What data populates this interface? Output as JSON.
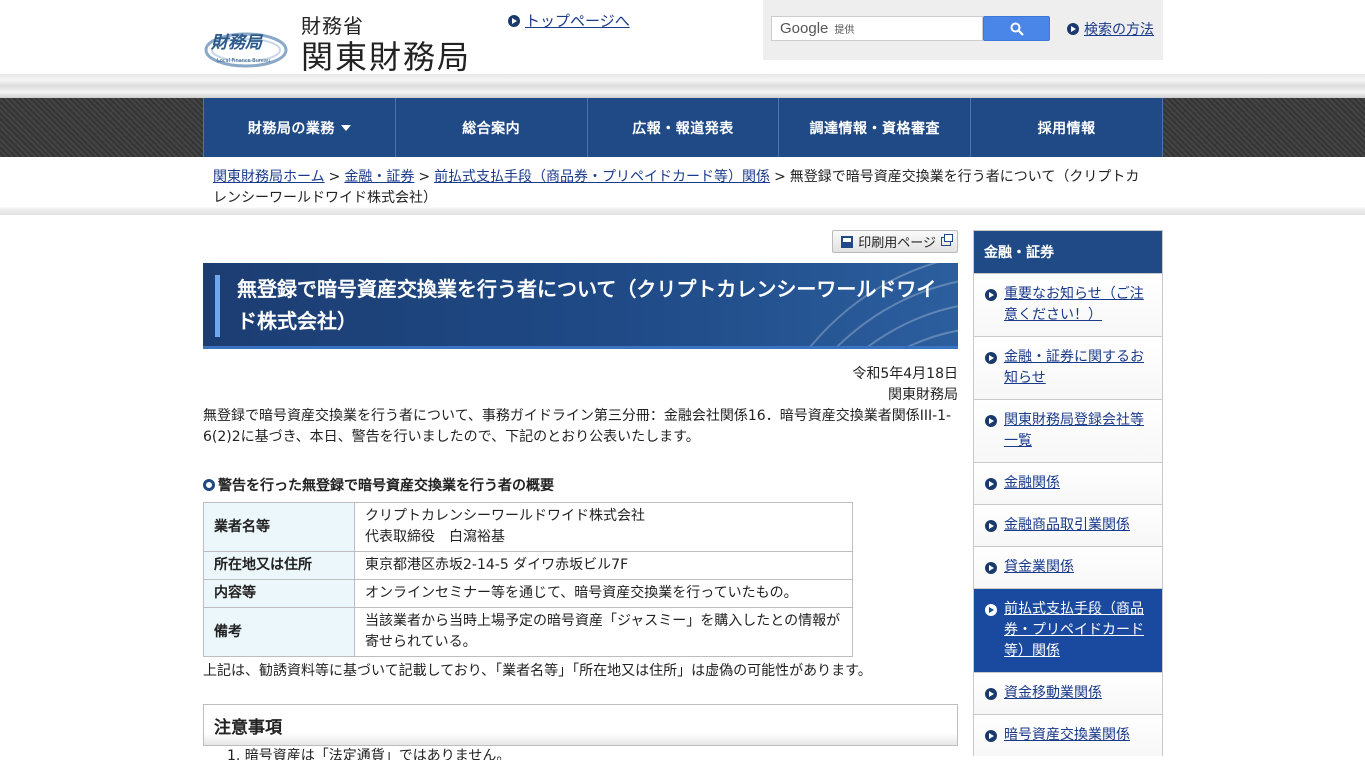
{
  "header": {
    "logo_small": "財務省",
    "logo_big": "関東財務局",
    "logo_emblem_text": "財務局",
    "logo_emblem_sub": "Local Finance Bureau",
    "top_link": "トップページへ",
    "search": {
      "google_label": "Google",
      "provided_label": "提供",
      "help_link": "検索の方法"
    }
  },
  "nav": {
    "items": [
      {
        "label": "財務局の業務",
        "has_dropdown": true
      },
      {
        "label": "総合案内"
      },
      {
        "label": "広報・報道発表"
      },
      {
        "label": "調達情報・資格審査"
      },
      {
        "label": "採用情報"
      }
    ]
  },
  "breadcrumb": {
    "items": [
      "関東財務局ホーム",
      "金融・証券",
      "前払式支払手段（商品券・プリペイドカード等）関係"
    ],
    "current": "無登録で暗号資産交換業を行う者について（クリプトカレンシーワールドワイド株式会社）",
    "separator": ">"
  },
  "main": {
    "print_label": "印刷用ページ",
    "title": "無登録で暗号資産交換業を行う者について（クリプトカレンシーワールドワイド株式会社）",
    "date": "令和5年4月18日",
    "issuer": "関東財務局",
    "intro": "無登録で暗号資産交換業を行う者について、事務ガイドライン第三分冊：金融会社関係16．暗号資産交換業者関係III-1-6(2)2に基づき、本日、警告を行いましたので、下記のとおり公表いたします。",
    "section_heading": "警告を行った無登録で暗号資産交換業を行う者の概要",
    "table": [
      {
        "label": "業者名等",
        "value_lines": [
          "クリプトカレンシーワールドワイド株式会社",
          "代表取締役　白瀉裕基"
        ]
      },
      {
        "label": "所在地又は住所",
        "value_lines": [
          "東京都港区赤坂2-14-5  ダイワ赤坂ビル7F"
        ]
      },
      {
        "label": "内容等",
        "value_lines": [
          "オンラインセミナー等を通じて、暗号資産交換業を行っていたもの。"
        ]
      },
      {
        "label": "備考",
        "value_lines": [
          "当該業者から当時上場予定の暗号資産「ジャスミー」を購入したとの情報が寄せられている。"
        ]
      }
    ],
    "note": "上記は、勧誘資料等に基づいて記載しており、「業者名等」「所在地又は住所」は虚偽の可能性があります。",
    "caution_heading": "注意事項",
    "caution_items": [
      "1. 暗号資産は「法定通貨」ではありません。"
    ]
  },
  "sidebar": {
    "heading": "金融・証券",
    "items": [
      {
        "label": "重要なお知らせ（ご注意ください！）"
      },
      {
        "label": "金融・証券に関するお知らせ"
      },
      {
        "label": "関東財務局登録会社等一覧"
      },
      {
        "label": "金融関係"
      },
      {
        "label": "金融商品取引業関係"
      },
      {
        "label": "貸金業関係"
      },
      {
        "label": "前払式支払手段（商品券・プリペイドカード等）関係",
        "active": true
      },
      {
        "label": "資金移動業関係"
      },
      {
        "label": "暗号資産交換業関係"
      }
    ]
  },
  "colors": {
    "navy": "#1f4a86",
    "link": "#1a3a8a",
    "table_header_bg": "#ecf7fb",
    "active_sidebar": "#1a4aa0"
  }
}
